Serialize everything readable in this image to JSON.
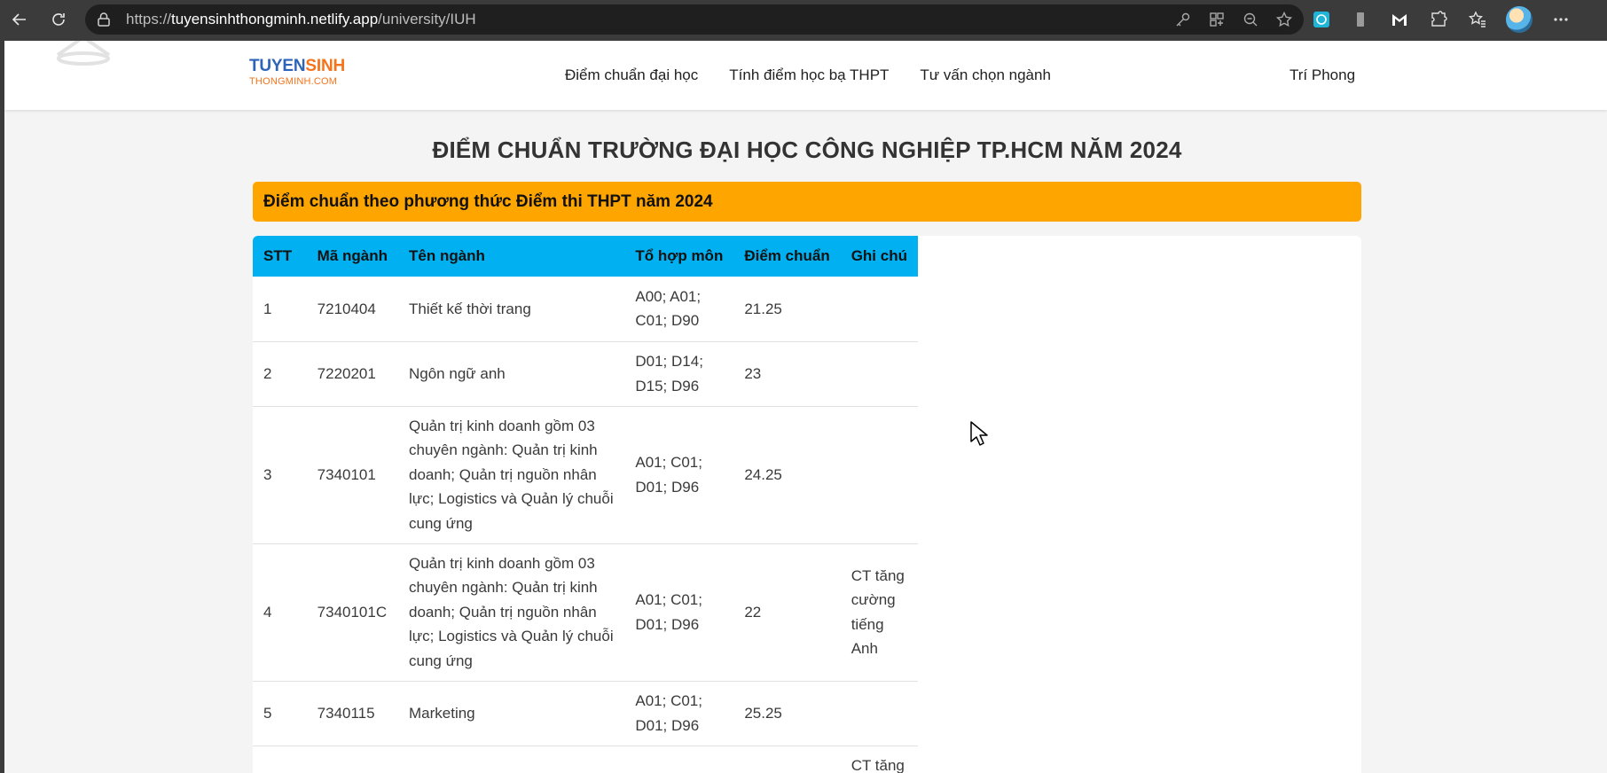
{
  "browser": {
    "url_scheme": "https://",
    "url_host": "tuyensinhthongminh.netlify.app",
    "url_path": "/university/IUH",
    "icons": [
      "back-icon",
      "refresh-icon",
      "lock-icon",
      "key-icon",
      "app-grid-icon",
      "zoom-out-icon",
      "star-icon",
      "extension-icon",
      "bookmark-icon",
      "malwarebytes-icon",
      "puzzle-icon",
      "favorites-icon",
      "avatar",
      "more-icon"
    ]
  },
  "header": {
    "logo_top_1": "TUYEN",
    "logo_top_2": "SINH",
    "logo_sub": "THONGMINH.COM",
    "nav": [
      "Điểm chuẩn đại học",
      "Tính điểm học bạ THPT",
      "Tư vấn chọn ngành"
    ],
    "user": "Trí Phong"
  },
  "page": {
    "title": "ĐIỂM CHUẨN TRƯỜNG ĐẠI HỌC CÔNG NGHIỆP TP.HCM NĂM 2024",
    "method_banner": "Điểm chuẩn theo phương thức Điểm thi THPT năm 2024"
  },
  "table": {
    "headers": {
      "stt": "STT",
      "ma": "Mã ngành",
      "ten": "Tên ngành",
      "tohop": "Tổ hợp môn",
      "diem": "Điểm chuẩn",
      "ghichu": "Ghi chú"
    },
    "rows": [
      {
        "stt": "1",
        "ma": "7210404",
        "ten": [
          "Thiết kế thời trang"
        ],
        "tohop": [
          "A00; A01;",
          "C01; D90"
        ],
        "diem": "21.25",
        "ghichu": []
      },
      {
        "stt": "2",
        "ma": "7220201",
        "ten": [
          "Ngôn ngữ anh"
        ],
        "tohop": [
          "D01; D14;",
          "D15; D96"
        ],
        "diem": "23",
        "ghichu": []
      },
      {
        "stt": "3",
        "ma": "7340101",
        "ten": [
          "Quản trị kinh doanh gồm 03",
          "chuyên ngành: Quản trị kinh",
          "doanh; Quản trị nguồn nhân",
          "lực; Logistics và Quản lý chuỗi",
          "cung ứng"
        ],
        "tohop": [
          "A01; C01;",
          "D01; D96"
        ],
        "diem": "24.25",
        "ghichu": []
      },
      {
        "stt": "4",
        "ma": "7340101C",
        "ten": [
          "Quản trị kinh doanh gồm 03",
          "chuyên ngành: Quản trị kinh",
          "doanh; Quản trị nguồn nhân",
          "lực; Logistics và Quản lý chuỗi",
          "cung ứng"
        ],
        "tohop": [
          "A01; C01;",
          "D01; D96"
        ],
        "diem": "22",
        "ghichu": [
          "CT tăng",
          "cường",
          "tiếng",
          "Anh"
        ]
      },
      {
        "stt": "5",
        "ma": "7340115",
        "ten": [
          "Marketing"
        ],
        "tohop": [
          "A01; C01;",
          "D01; D96"
        ],
        "diem": "25.25",
        "ghichu": []
      },
      {
        "stt": "",
        "ma": "",
        "ten": [],
        "tohop": [],
        "diem": "",
        "ghichu": [
          "CT tăng"
        ]
      }
    ]
  }
}
